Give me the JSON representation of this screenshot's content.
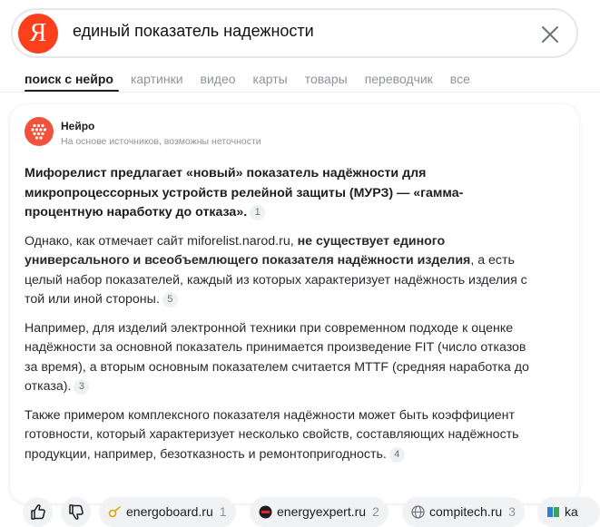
{
  "search": {
    "query": "единый показатель надежности",
    "logo_letter": "Я"
  },
  "tabs": [
    {
      "label": "поиск с нейро",
      "active": true
    },
    {
      "label": "картинки"
    },
    {
      "label": "видео"
    },
    {
      "label": "карты"
    },
    {
      "label": "товары"
    },
    {
      "label": "переводчик"
    },
    {
      "label": "все"
    }
  ],
  "neuro": {
    "name": "Нейро",
    "note": "На основе источников, возможны неточности"
  },
  "answer": {
    "p1": {
      "text": "Мифорелист предлагает «новый» показатель надёжности для микропроцессорных устройств релейной защиты (МУРЗ) — «гамма-процентную наработку до отказа».",
      "ref": "1"
    },
    "p2": {
      "text_a": "Однако, как отмечает сайт miforelist.narod.ru, ",
      "text_bold": "не существует единого универсального и всеобъемлющего показателя надёжности изделия",
      "text_b": ", а есть целый набор показателей, каждый из которых характеризует надёжность изделия с той или иной стороны.",
      "ref": "5"
    },
    "p3": {
      "text": "Например, для изделий электронной техники при современном подходе к оценке надёжности за основной показатель принимается произведение FIT (число отказов за время), а вторым основным показателем считается MTTF (средняя наработка до отказа).",
      "ref": "3"
    },
    "p4": {
      "text": "Также примером комплексного показателя надёжности может быть коэффициент готовности, который характеризует несколько свойств, составляющих надёжность продукции, например, безотказность и ремонтопригодность.",
      "ref": "4"
    }
  },
  "sources": [
    {
      "name": "energoboard.ru",
      "num": "1",
      "icon": "energoboard-favicon"
    },
    {
      "name": "energyexpert.ru",
      "num": "2",
      "icon": "energyexpert-favicon"
    },
    {
      "name": "compitech.ru",
      "num": "3",
      "icon": "globe-icon"
    },
    {
      "name": "ka",
      "icon": "book-favicon"
    }
  ],
  "colors": {
    "brand": "#fc3f1d",
    "neuro": "#f2513b",
    "muted": "#8f929a",
    "chip_bg": "#f1f2f4"
  }
}
